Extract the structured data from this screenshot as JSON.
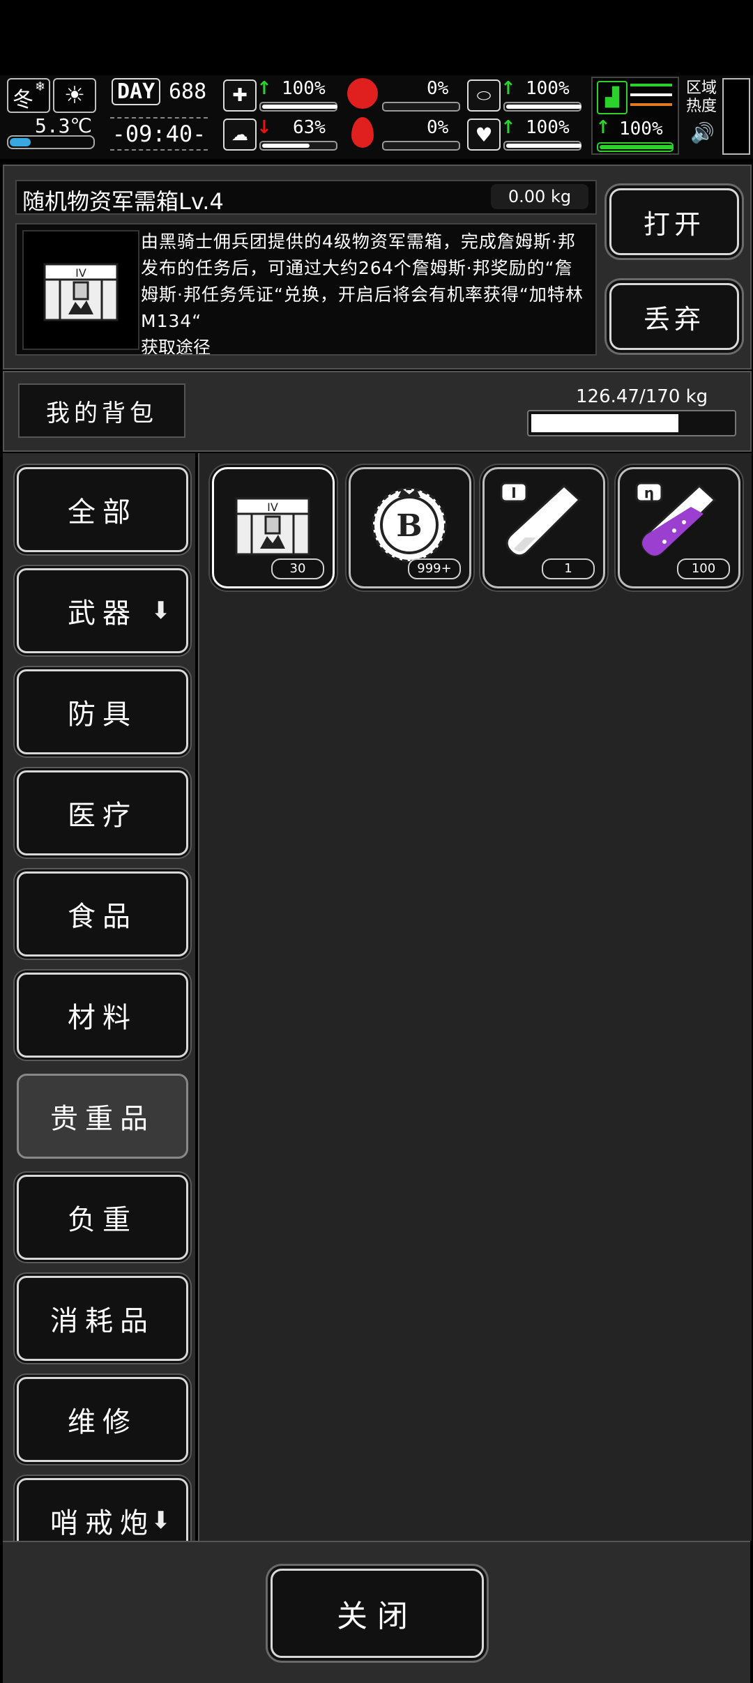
{
  "status": {
    "season": "冬",
    "temperature": "5.3℃",
    "day_label": "DAY",
    "day_value": "688",
    "time": "-09:40-",
    "stats": [
      {
        "name": "health",
        "value": "100%",
        "trend": "up",
        "level": 1.0
      },
      {
        "name": "stomach",
        "value": "0%",
        "trend": "none",
        "level": 0.0
      },
      {
        "name": "pill",
        "value": "100%",
        "trend": "up",
        "level": 1.0
      },
      {
        "name": "brain",
        "value": "63%",
        "trend": "down",
        "level": 0.63
      },
      {
        "name": "blood",
        "value": "0%",
        "trend": "none",
        "level": 0.0
      },
      {
        "name": "heart",
        "value": "100%",
        "trend": "up",
        "level": 1.0
      }
    ],
    "stamina_value": "100%",
    "stamina_level": 1.0,
    "region_label": "区域\n热度",
    "colors": {
      "up": "#2bd22b",
      "down": "#e11111",
      "stomach": "#e0201e",
      "blood": "#e0201e",
      "stamina": "#2bd22b"
    }
  },
  "item": {
    "name": "随机物资军需箱Lv.4",
    "weight": "0.00 kg",
    "description": "由黑骑士佣兵团提供的4级物资军需箱，完成詹姆斯·邦发布的任务后，可通过大约264个詹姆斯·邦奖励的“詹姆斯·邦任务凭证“兑换，开启后将会有机率获得“加特林M134“",
    "description_cut": "获取途径",
    "open_button": "打开",
    "discard_button": "丢弃"
  },
  "backpack": {
    "title": "我的背包",
    "capacity": "126.47/170 kg",
    "fill": 0.744
  },
  "categories": [
    {
      "label": "全部",
      "arrow": false,
      "active": false
    },
    {
      "label": "武器",
      "arrow": true,
      "active": false
    },
    {
      "label": "防具",
      "arrow": false,
      "active": false
    },
    {
      "label": "医疗",
      "arrow": false,
      "active": false
    },
    {
      "label": "食品",
      "arrow": false,
      "active": false
    },
    {
      "label": "材料",
      "arrow": false,
      "active": false
    },
    {
      "label": "贵重品",
      "arrow": false,
      "active": true
    },
    {
      "label": "负重",
      "arrow": false,
      "active": false
    },
    {
      "label": "消耗品",
      "arrow": false,
      "active": false
    },
    {
      "label": "维修",
      "arrow": false,
      "active": false
    },
    {
      "label": "哨戒炮",
      "arrow": true,
      "active": false
    }
  ],
  "slots": [
    {
      "name": "supply-crate",
      "count": "30",
      "selected": true,
      "icon": "crate-icon"
    },
    {
      "name": "b-token",
      "count": "999+",
      "selected": false,
      "icon": "b-coin-icon"
    },
    {
      "name": "test-tube-i",
      "count": "1",
      "selected": false,
      "icon": "test-tube-icon"
    },
    {
      "name": "test-tube-eta",
      "count": "100",
      "selected": false,
      "icon": "purple-tube-icon"
    }
  ],
  "close_button": "关闭"
}
